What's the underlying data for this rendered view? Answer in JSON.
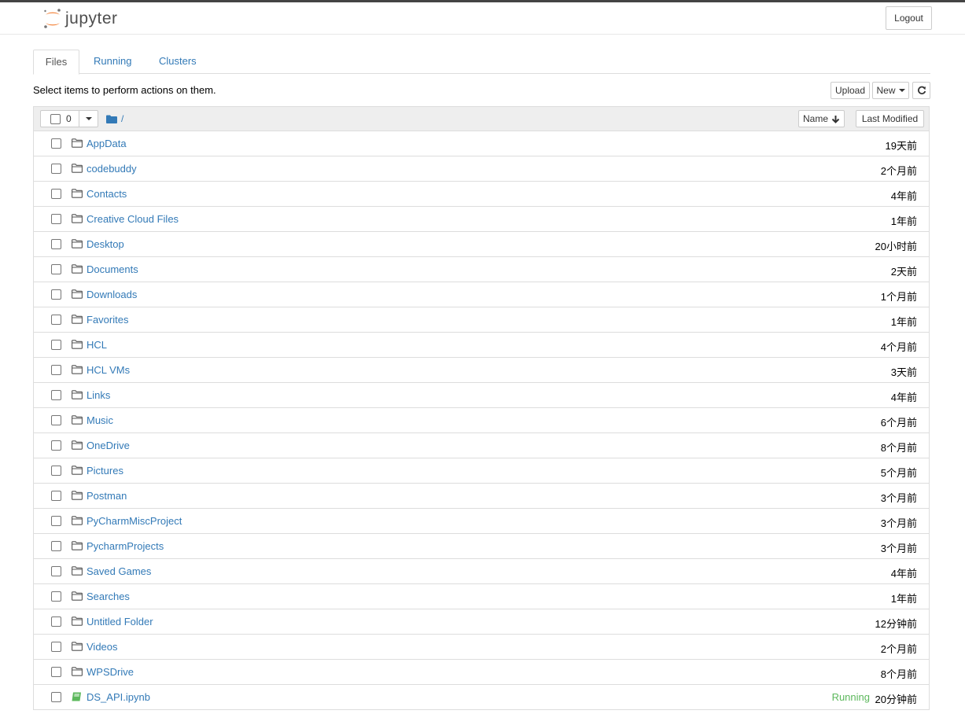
{
  "header": {
    "logo_text": "jupyter",
    "logout_label": "Logout"
  },
  "tabs": [
    {
      "label": "Files",
      "active": true
    },
    {
      "label": "Running",
      "active": false
    },
    {
      "label": "Clusters",
      "active": false
    }
  ],
  "toolbar": {
    "hint": "Select items to perform actions on them.",
    "upload_label": "Upload",
    "new_label": "New",
    "refresh_icon": "refresh-icon"
  },
  "list_header": {
    "selected_count": "0",
    "breadcrumb": "/",
    "sort_name_label": "Name",
    "sort_name_icon": "arrow-down-icon",
    "last_modified_label": "Last Modified"
  },
  "items": [
    {
      "name": "AppData",
      "modified": "19天前",
      "type": "folder"
    },
    {
      "name": "codebuddy",
      "modified": "2个月前",
      "type": "folder"
    },
    {
      "name": "Contacts",
      "modified": "4年前",
      "type": "folder"
    },
    {
      "name": "Creative Cloud Files",
      "modified": "1年前",
      "type": "folder"
    },
    {
      "name": "Desktop",
      "modified": "20小时前",
      "type": "folder"
    },
    {
      "name": "Documents",
      "modified": "2天前",
      "type": "folder"
    },
    {
      "name": "Downloads",
      "modified": "1个月前",
      "type": "folder"
    },
    {
      "name": "Favorites",
      "modified": "1年前",
      "type": "folder"
    },
    {
      "name": "HCL",
      "modified": "4个月前",
      "type": "folder"
    },
    {
      "name": "HCL VMs",
      "modified": "3天前",
      "type": "folder"
    },
    {
      "name": "Links",
      "modified": "4年前",
      "type": "folder"
    },
    {
      "name": "Music",
      "modified": "6个月前",
      "type": "folder"
    },
    {
      "name": "OneDrive",
      "modified": "8个月前",
      "type": "folder"
    },
    {
      "name": "Pictures",
      "modified": "5个月前",
      "type": "folder"
    },
    {
      "name": "Postman",
      "modified": "3个月前",
      "type": "folder"
    },
    {
      "name": "PyCharmMiscProject",
      "modified": "3个月前",
      "type": "folder"
    },
    {
      "name": "PycharmProjects",
      "modified": "3个月前",
      "type": "folder"
    },
    {
      "name": "Saved Games",
      "modified": "4年前",
      "type": "folder"
    },
    {
      "name": "Searches",
      "modified": "1年前",
      "type": "folder"
    },
    {
      "name": "Untitled Folder",
      "modified": "12分钟前",
      "type": "folder"
    },
    {
      "name": "Videos",
      "modified": "2个月前",
      "type": "folder"
    },
    {
      "name": "WPSDrive",
      "modified": "8个月前",
      "type": "folder"
    },
    {
      "name": "DS_API.ipynb",
      "modified": "20分钟前",
      "type": "notebook",
      "status": "Running"
    }
  ],
  "colors": {
    "link": "#337ab7",
    "running": "#5cb85c",
    "logo_orange": "#f37726",
    "logo_gray": "#767677"
  }
}
